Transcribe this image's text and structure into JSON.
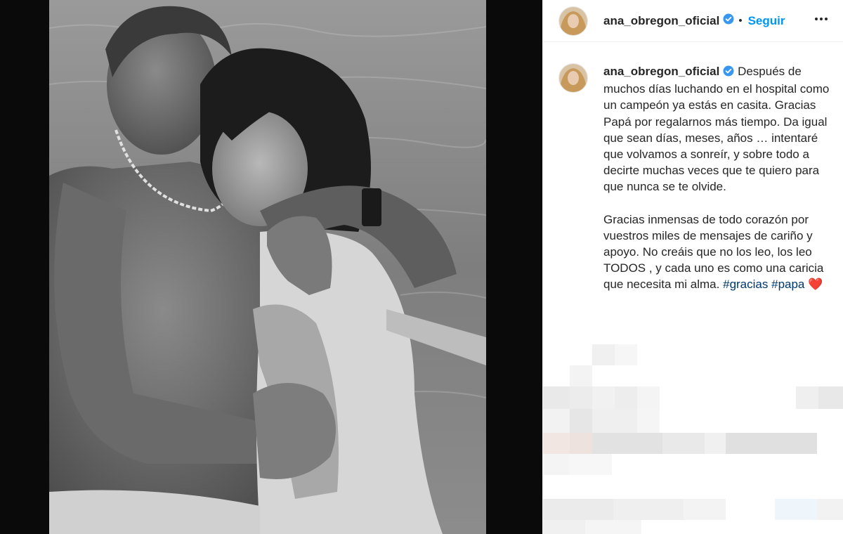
{
  "header": {
    "username": "ana_obregon_oficial",
    "separator": "•",
    "follow_label": "Seguir"
  },
  "caption": {
    "username": "ana_obregon_oficial",
    "paragraph1": "Después de muchos días luchando en el hospital como un campeón ya estás en casita. Gracias Papá por regalarnos más tiempo. Da igual que sean días, meses, años … intentaré que volvamos a sonreír, y sobre todo a decirte muchas veces que te quiero para que nunca se te olvide.",
    "paragraph2": "Gracias inmensas de todo corazón por vuestros miles de mensajes de cariño y apoyo. No creáis que no los leo, los leo TODOS , y cada uno es como una caricia que necesita mi alma.",
    "hashtag1": "#gracias",
    "hashtag2": "#papa",
    "emoji": "❤️"
  },
  "colors": {
    "accent": "#0095f6",
    "verified": "#3897f0",
    "hashtag": "#00376b"
  },
  "icons": [
    "verified-badge-icon",
    "more-options-icon",
    "heart-emoji-icon"
  ]
}
